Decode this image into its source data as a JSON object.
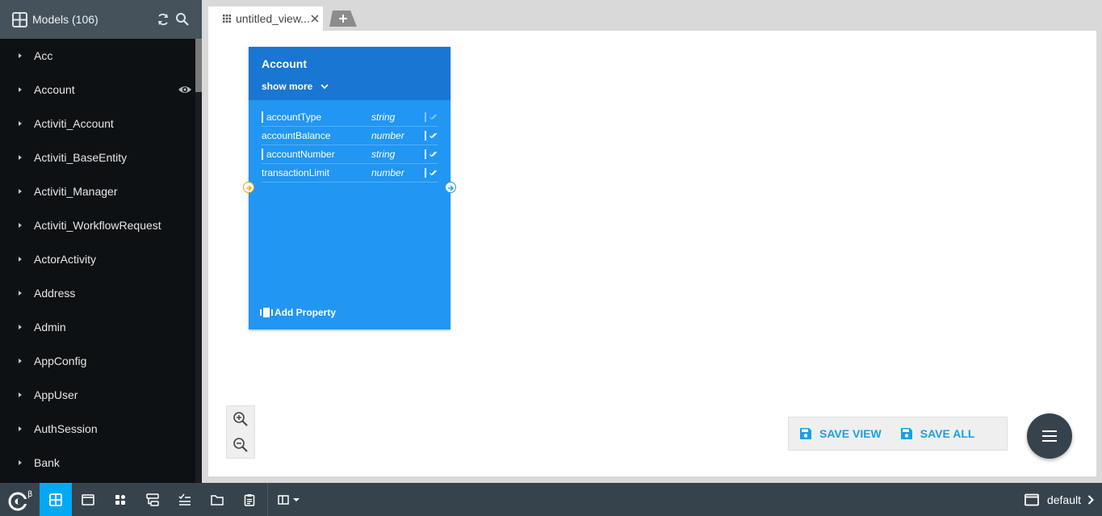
{
  "sidebar": {
    "title": "Models (106)",
    "models": [
      {
        "label": "Acc"
      },
      {
        "label": "Account",
        "visible": true
      },
      {
        "label": "Activiti_Account"
      },
      {
        "label": "Activiti_BaseEntity"
      },
      {
        "label": "Activiti_Manager"
      },
      {
        "label": "Activiti_WorkflowRequest"
      },
      {
        "label": "ActorActivity"
      },
      {
        "label": "Address"
      },
      {
        "label": "Admin"
      },
      {
        "label": "AppConfig"
      },
      {
        "label": "AppUser"
      },
      {
        "label": "AuthSession"
      },
      {
        "label": "Bank"
      }
    ]
  },
  "tabs": [
    {
      "label": "untitled_view..."
    }
  ],
  "card": {
    "title": "Account",
    "show_more": "show more",
    "properties": [
      {
        "name": "accountType",
        "type": "string",
        "required_marker": true,
        "checked": false
      },
      {
        "name": "accountBalance",
        "type": "number",
        "required_marker": false,
        "checked": true
      },
      {
        "name": "accountNumber",
        "type": "string",
        "required_marker": true,
        "checked": true
      },
      {
        "name": "transactionLimit",
        "type": "number",
        "required_marker": false,
        "checked": true
      }
    ],
    "add_property": "Add Property"
  },
  "actions": {
    "save_view": "SAVE VIEW",
    "save_all": "SAVE ALL"
  },
  "footer": {
    "workspace": "default"
  },
  "colors": {
    "accent": "#03a9f4",
    "card": "#2196f3",
    "card_header": "#1976d2",
    "sidebar": "#0e1114",
    "toolbar": "#37434c"
  }
}
